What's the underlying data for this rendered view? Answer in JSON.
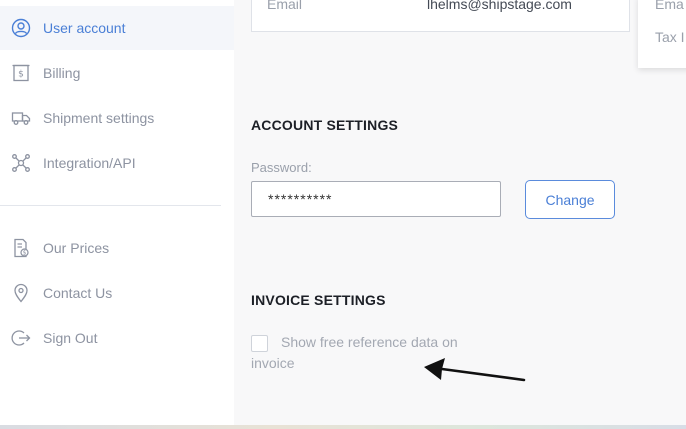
{
  "sidebar": {
    "items": [
      {
        "label": "User account",
        "icon": "user-circle-icon",
        "active": true
      },
      {
        "label": "Billing",
        "icon": "receipt-dollar-icon",
        "active": false
      },
      {
        "label": "Shipment settings",
        "icon": "truck-icon",
        "active": false
      },
      {
        "label": "Integration/API",
        "icon": "network-nodes-icon",
        "active": false
      },
      {
        "label": "Our Prices",
        "icon": "price-list-icon",
        "active": false
      },
      {
        "label": "Contact Us",
        "icon": "map-pin-icon",
        "active": false
      },
      {
        "label": "Sign Out",
        "icon": "sign-out-icon",
        "active": false
      }
    ]
  },
  "profile": {
    "email_label": "Email",
    "email_value": "lhelms@shipstage.com"
  },
  "side_card": {
    "line1": "Ema",
    "line2": "Tax I"
  },
  "account_settings": {
    "title": "ACCOUNT SETTINGS",
    "password_label": "Password:",
    "password_value": "**********",
    "change_label": "Change"
  },
  "invoice_settings": {
    "title": "INVOICE SETTINGS",
    "checkbox_label_line1": "Show free reference data on",
    "checkbox_label_line2": "invoice",
    "checkbox_checked": false
  },
  "colors": {
    "accent": "#4a7fd6",
    "active_bg": "#f4f6fa",
    "muted_text": "#8d93a1",
    "heading": "#1c1f26"
  }
}
